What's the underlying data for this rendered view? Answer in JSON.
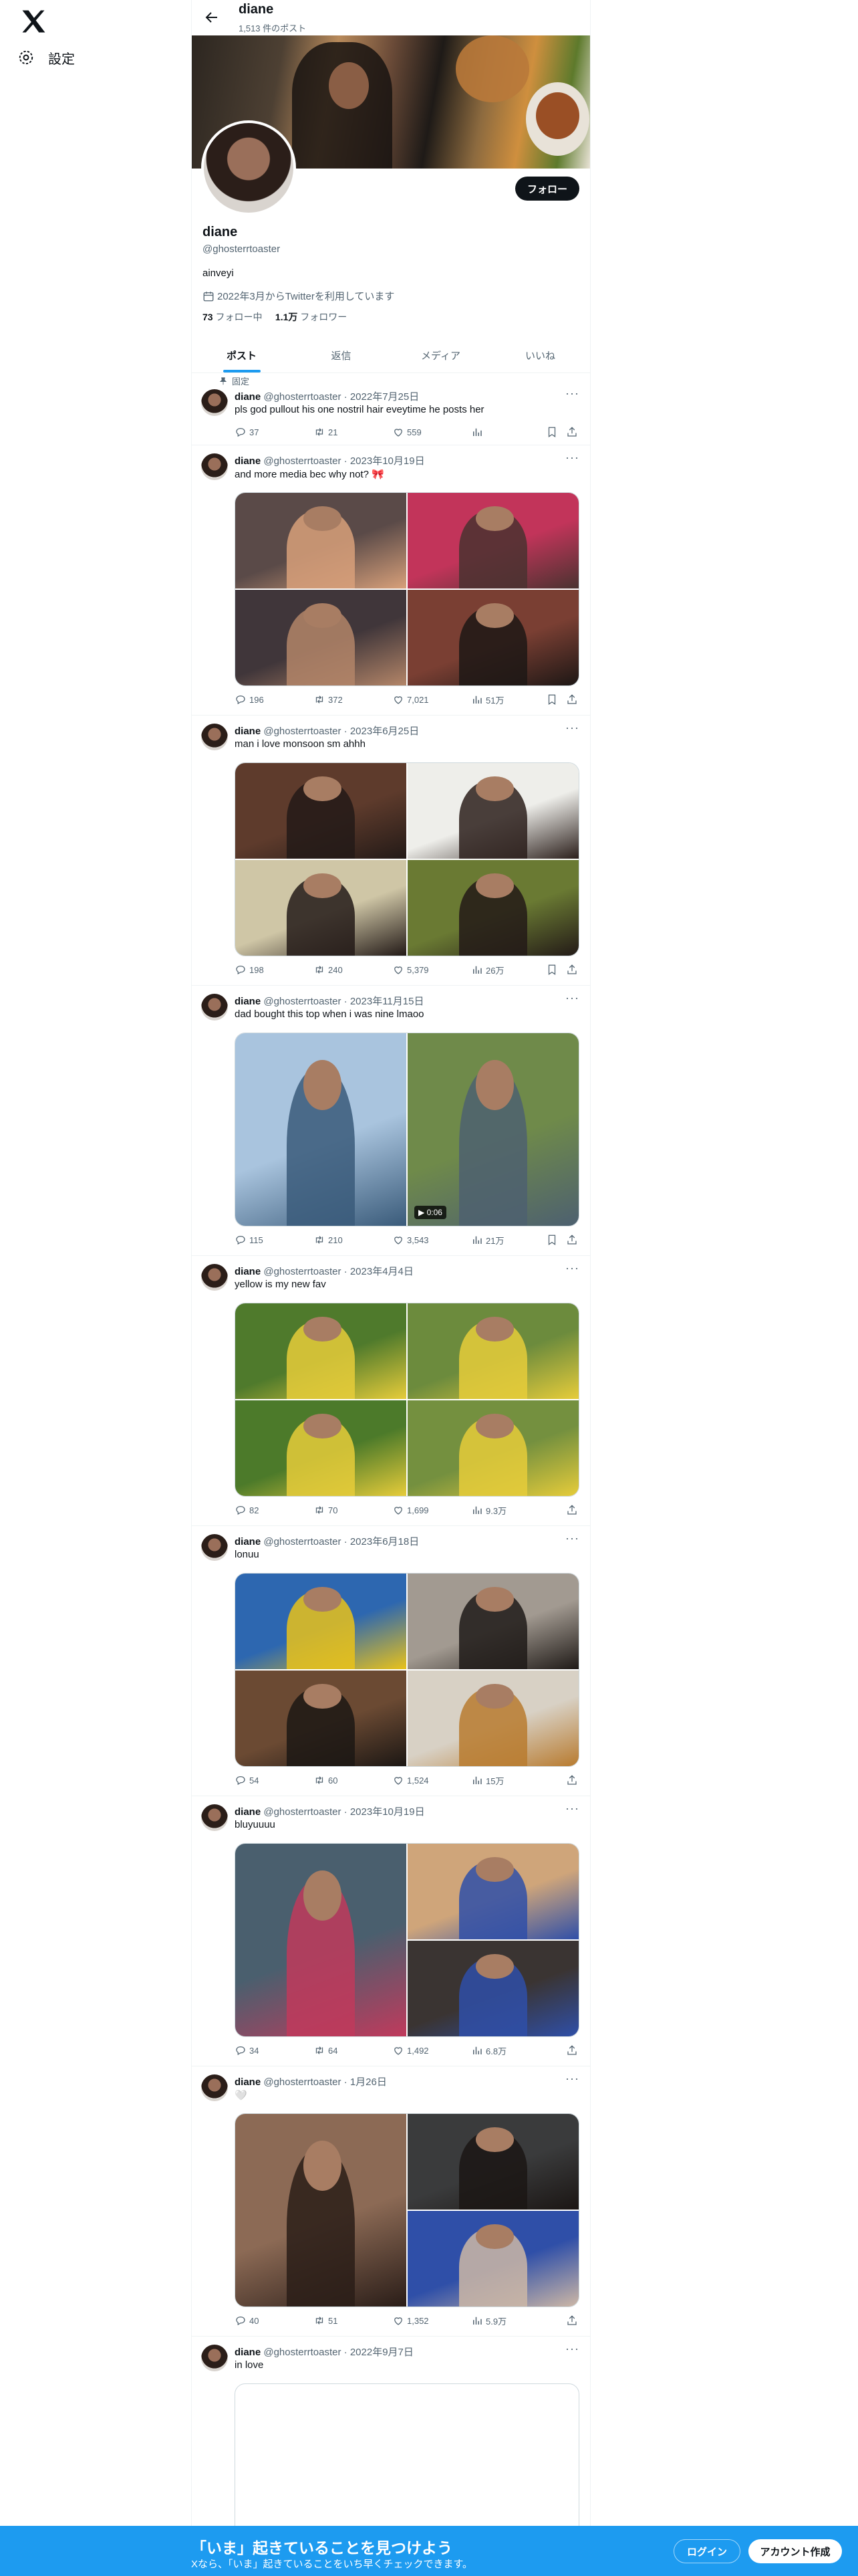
{
  "nav": {
    "settings_label": "設定"
  },
  "header": {
    "name": "diane",
    "post_count": "1,513 件のポスト"
  },
  "profile": {
    "follow_label": "フォロー",
    "name": "diane",
    "handle": "@ghosterrtoaster",
    "bio": "ainveyi",
    "joined": "2022年3月からTwitterを利用しています",
    "following_count": "73",
    "following_label": "フォロー中",
    "followers_count": "1.1万",
    "followers_label": "フォロワー"
  },
  "tabs": [
    "ポスト",
    "返信",
    "メディア",
    "いいね"
  ],
  "pinned_label": "固定",
  "tweets": [
    {
      "name": "diane",
      "handle": "@ghosterrtoaster",
      "date": "2022年7月25日",
      "text": "pls god pullout his one nostril hair eveytime he posts her",
      "replies": "37",
      "retweets": "21",
      "likes": "559",
      "views": ""
    },
    {
      "name": "diane",
      "handle": "@ghosterrtoaster",
      "date": "2023年10月19日",
      "text": "and more media bec why not? 🎀",
      "replies": "196",
      "retweets": "372",
      "likes": "7,021",
      "views": "51万"
    },
    {
      "name": "diane",
      "handle": "@ghosterrtoaster",
      "date": "2023年6月25日",
      "text": "man i love monsoon sm ahhh",
      "replies": "198",
      "retweets": "240",
      "likes": "5,379",
      "views": "26万"
    },
    {
      "name": "diane",
      "handle": "@ghosterrtoaster",
      "date": "2023年11月15日",
      "text": "dad bought this top when i was nine lmaoo",
      "replies": "115",
      "retweets": "210",
      "likes": "3,543",
      "views": "21万",
      "video_time": "0:06"
    },
    {
      "name": "diane",
      "handle": "@ghosterrtoaster",
      "date": "2023年4月4日",
      "text": "yellow is my new fav",
      "replies": "82",
      "retweets": "70",
      "likes": "1,699",
      "views": "9.3万"
    },
    {
      "name": "diane",
      "handle": "@ghosterrtoaster",
      "date": "2023年6月18日",
      "text": "lonuu",
      "replies": "54",
      "retweets": "60",
      "likes": "1,524",
      "views": "15万"
    },
    {
      "name": "diane",
      "handle": "@ghosterrtoaster",
      "date": "2023年10月19日",
      "text": "bluyuuuu",
      "replies": "34",
      "retweets": "64",
      "likes": "1,492",
      "views": "6.8万"
    },
    {
      "name": "diane",
      "handle": "@ghosterrtoaster",
      "date": "1月26日",
      "text": "🤍",
      "replies": "40",
      "retweets": "51",
      "likes": "1,352",
      "views": "5.9万"
    },
    {
      "name": "diane",
      "handle": "@ghosterrtoaster",
      "date": "2022年9月7日",
      "text": "in love",
      "replies": "",
      "retweets": "",
      "likes": "",
      "views": ""
    }
  ],
  "bottom_bar": {
    "title": "「いま」起きていることを見つけよう",
    "subtitle": "Xなら、「いま」起きていることをいち早くチェックできます。",
    "login_label": "ログイン",
    "signup_label": "アカウント作成"
  },
  "colors": {
    "accent": "#1d9bf0",
    "text": "#0f1419",
    "muted": "#536471"
  }
}
